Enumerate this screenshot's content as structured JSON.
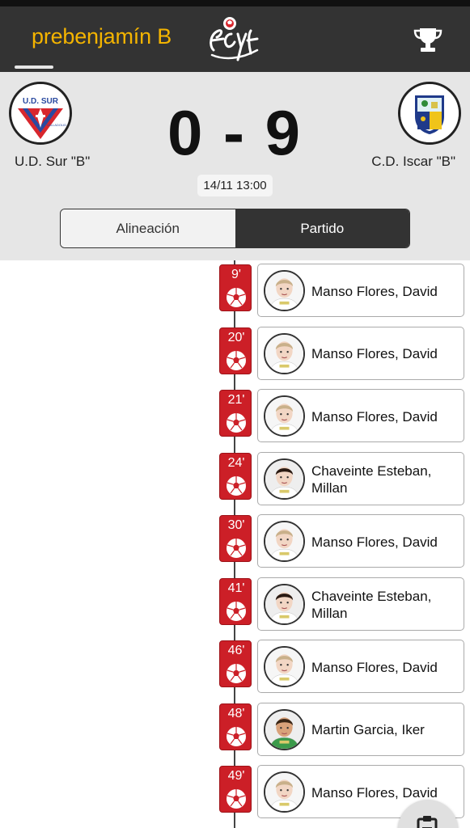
{
  "header": {
    "title": "prebenjamín B",
    "logo_icon": "fcyf-logo",
    "trophy_icon": "trophy-icon",
    "title_color": "#f4b400",
    "bar_color": "#333333"
  },
  "match": {
    "home_team": "U.D. Sur \"B\"",
    "away_team": "C.D. Iscar \"B\"",
    "home_crest_text": "U.D. SUR",
    "home_crest_subtext": "VALLADOLID",
    "score": "0 - 9",
    "datetime": "14/11 13:00"
  },
  "tabs": [
    {
      "label": "Alineación",
      "active": false
    },
    {
      "label": "Partido",
      "active": true
    }
  ],
  "events": [
    {
      "minute": "9'",
      "player_line1": "Manso Flores, David",
      "player_line2": "",
      "avatar": "boy-blond"
    },
    {
      "minute": "20'",
      "player_line1": "Manso Flores, David",
      "player_line2": "",
      "avatar": "boy-blond"
    },
    {
      "minute": "21'",
      "player_line1": "Manso Flores, David",
      "player_line2": "",
      "avatar": "boy-blond"
    },
    {
      "minute": "24'",
      "player_line1": "Chaveinte Esteban,",
      "player_line2": "Millan",
      "avatar": "boy-dark"
    },
    {
      "minute": "30'",
      "player_line1": "Manso Flores, David",
      "player_line2": "",
      "avatar": "boy-blond"
    },
    {
      "minute": "41'",
      "player_line1": "Chaveinte Esteban,",
      "player_line2": "Millan",
      "avatar": "boy-dark"
    },
    {
      "minute": "46'",
      "player_line1": "Manso Flores, David",
      "player_line2": "",
      "avatar": "boy-blond"
    },
    {
      "minute": "48'",
      "player_line1": "Martin Garcia, Iker",
      "player_line2": "",
      "avatar": "boy-tan"
    },
    {
      "minute": "49'",
      "player_line1": "Manso Flores, David",
      "player_line2": "",
      "avatar": "boy-blond"
    }
  ],
  "event_type_icon": "soccer-ball-icon",
  "fab_icon": "clipboard-icon",
  "colors": {
    "goal_badge": "#cc1f27",
    "scoreboard_bg": "#e6e6e6"
  }
}
